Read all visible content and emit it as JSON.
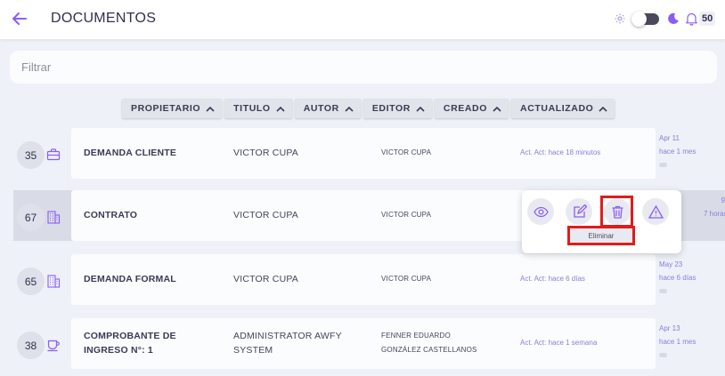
{
  "header": {
    "title": "DOCUMENTOS",
    "notifications_count": "50"
  },
  "filter": {
    "placeholder": "Filtrar"
  },
  "sort_buttons": [
    "PROPIETARIO",
    "TITULO",
    "AUTOR",
    "EDITOR",
    "CREADO",
    "ACTUALIZADO"
  ],
  "rows": [
    {
      "number": "35",
      "icon": "briefcase-icon",
      "title": "DEMANDA CLIENTE",
      "owner": "VICTOR CUPA",
      "author_line1": "VICTOR CUPA",
      "author_line2": "",
      "updated": "Act. Act: hace 18 minutos",
      "side_date": "Apr 11",
      "side_ago": "hace 1 mes"
    },
    {
      "number": "67",
      "icon": "building-icon",
      "title": "CONTRATO",
      "owner": "VICTOR CUPA",
      "author_line1": "VICTOR CUPA",
      "author_line2": "",
      "updated": "",
      "side_date": "9",
      "side_ago": "7 horas"
    },
    {
      "number": "65",
      "icon": "building-icon",
      "title": "DEMANDA FORMAL",
      "owner": "VICTOR CUPA",
      "author_line1": "VICTOR CUPA",
      "author_line2": "",
      "updated": "Act. Act: hace 6 días",
      "side_date": "May 23",
      "side_ago": "hace 6 días"
    },
    {
      "number": "38",
      "icon": "cup-icon",
      "title": "COMPROBANTE DE INGRESO N°: 1",
      "owner": "ADMINISTRATOR AWFY SYSTEM",
      "author_line1": "FENNER EDUARDO",
      "author_line2": "GONZÁLEZ CASTELLANOS",
      "updated": "Act. Act: hace 1 semana",
      "side_date": "Apr 13",
      "side_ago": "hace 1 mes"
    }
  ],
  "actions_popup": {
    "tooltip": "Eliminar",
    "actions": [
      "view",
      "edit",
      "delete",
      "report"
    ]
  },
  "colors": {
    "accent": "#8a5cf5",
    "highlight": "#e21b1b",
    "background": "#eef1f8"
  }
}
